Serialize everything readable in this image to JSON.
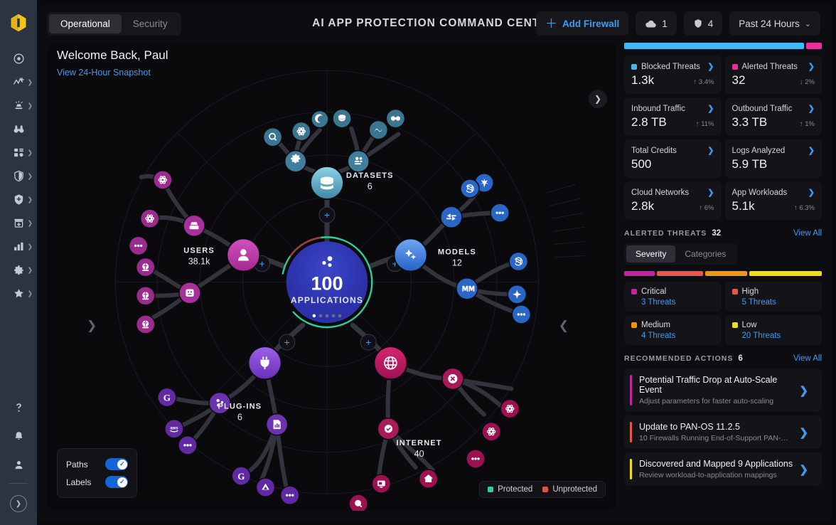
{
  "rail": {
    "logo": "cortex-logo",
    "items": [
      {
        "name": "dashboard",
        "icon": "target-icon",
        "chevron": false
      },
      {
        "name": "incidents",
        "icon": "activity-plus-icon",
        "chevron": true
      },
      {
        "name": "alerts",
        "icon": "alert-beacon-icon",
        "chevron": true
      },
      {
        "name": "investigation",
        "icon": "binoculars-icon",
        "chevron": false
      },
      {
        "name": "assets",
        "icon": "asset-grid-icon",
        "chevron": true
      },
      {
        "name": "protection",
        "icon": "shield-icon",
        "chevron": true
      },
      {
        "name": "posture",
        "icon": "shield-plus-icon",
        "chevron": true
      },
      {
        "name": "cases",
        "icon": "archive-plus-icon",
        "chevron": true
      },
      {
        "name": "reports",
        "icon": "bar-chart-icon",
        "chevron": true
      },
      {
        "name": "settings",
        "icon": "gear-icon",
        "chevron": true
      },
      {
        "name": "favorites",
        "icon": "star-icon",
        "chevron": true
      }
    ],
    "bottom": [
      {
        "name": "help",
        "icon": "question-mark-icon"
      },
      {
        "name": "notifications",
        "icon": "bell-icon"
      },
      {
        "name": "account",
        "icon": "person-icon"
      }
    ],
    "expand": "chevron-right-icon"
  },
  "header": {
    "tabs": [
      {
        "label": "Operational",
        "active": true
      },
      {
        "label": "Security",
        "active": false
      }
    ],
    "title": "AI APP PROTECTION COMMAND CENTER",
    "add_firewall": "Add Firewall",
    "cloud_count": "1",
    "shield_count": "4",
    "time_range": "Past 24 Hours"
  },
  "welcome": {
    "greeting": "Welcome Back, Paul",
    "link": "View 24-Hour Snapshot"
  },
  "graph": {
    "center": {
      "value": "100",
      "label": "APPLICATIONS",
      "dots": 5,
      "active_dot": 0
    },
    "clusters": [
      {
        "name": "datasets",
        "title": "DATASETS",
        "value": "6",
        "color": "#4f93ad"
      },
      {
        "name": "models",
        "title": "MODELS",
        "value": "12",
        "color": "#2f6fd0"
      },
      {
        "name": "internet",
        "title": "INTERNET",
        "value": "40",
        "color": "#b01e62"
      },
      {
        "name": "plug-ins",
        "title": "PLUG-INS",
        "value": "6",
        "color": "#7a3fc4"
      },
      {
        "name": "users",
        "title": "USERS",
        "value": "38.1k",
        "color": "#b0349c"
      }
    ],
    "toggles": [
      {
        "label": "Paths",
        "on": true
      },
      {
        "label": "Labels",
        "on": true
      }
    ],
    "legend": [
      {
        "label": "Protected",
        "color": "#2ecf9b"
      },
      {
        "label": "Unprotected",
        "color": "#e8514b"
      }
    ]
  },
  "stats": {
    "split": [
      {
        "color": "#3fb9f0",
        "pct": 92
      },
      {
        "color": "#ea2f9e",
        "pct": 8
      }
    ],
    "cards": [
      {
        "label": "Blocked Threats",
        "value": "1.3k",
        "delta": "3.4%",
        "dir": "up",
        "swatch": "#3fb9f0"
      },
      {
        "label": "Alerted Threats",
        "value": "32",
        "delta": "2%",
        "dir": "down",
        "swatch": "#ea2f9e"
      },
      {
        "label": "Inbound Traffic",
        "value": "2.8 TB",
        "delta": "11%",
        "dir": "up",
        "swatch": null
      },
      {
        "label": "Outbound Traffic",
        "value": "3.3 TB",
        "delta": "1%",
        "dir": "up",
        "swatch": null
      },
      {
        "label": "Total Credits",
        "value": "500",
        "delta": "",
        "dir": "",
        "swatch": null
      },
      {
        "label": "Logs Analyzed",
        "value": "5.9 TB",
        "delta": "",
        "dir": "",
        "swatch": null
      },
      {
        "label": "Cloud Networks",
        "value": "2.8k",
        "delta": "6%",
        "dir": "up",
        "swatch": null
      },
      {
        "label": "App Workloads",
        "value": "5.1k",
        "delta": "6.3%",
        "dir": "up",
        "swatch": null
      }
    ]
  },
  "alerted": {
    "title": "ALERTED THREATS",
    "count": "32",
    "view_all": "View All",
    "tabs": [
      {
        "label": "Severity",
        "active": true
      },
      {
        "label": "Categories",
        "active": false
      }
    ],
    "bar": [
      {
        "color": "#c0269b",
        "pct": 16
      },
      {
        "color": "#e8574c",
        "pct": 24
      },
      {
        "color": "#f0930f",
        "pct": 22
      },
      {
        "color": "#ece015",
        "pct": 38
      }
    ],
    "levels": [
      {
        "label": "Critical",
        "threats": "3 Threats",
        "color": "#c0269b"
      },
      {
        "label": "High",
        "threats": "5 Threats",
        "color": "#e8574c"
      },
      {
        "label": "Medium",
        "threats": "4 Threats",
        "color": "#f0930f"
      },
      {
        "label": "Low",
        "threats": "20 Threats",
        "color": "#ece015"
      }
    ]
  },
  "recommended": {
    "title": "RECOMMENDED ACTIONS",
    "count": "6",
    "view_all": "View All",
    "items": [
      {
        "title": "Potential Traffic Drop at Auto-Scale Event",
        "sub": "Adjust parameters for faster auto-scaling",
        "color": "#c0269b"
      },
      {
        "title": "Update to PAN-OS 11.2.5",
        "sub": "10 Firewalls Running End-of-Support PAN-OS…",
        "color": "#e8574c"
      },
      {
        "title": "Discovered and Mapped 9 Applications",
        "sub": "Review workload-to-application mappings",
        "color": "#ece015"
      }
    ]
  }
}
